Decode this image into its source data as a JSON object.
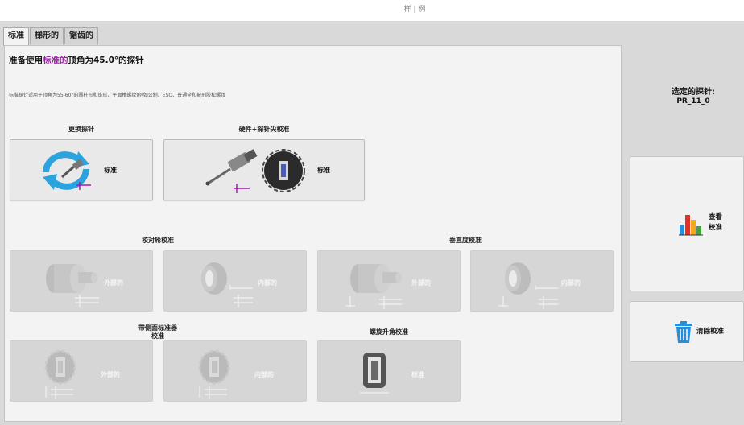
{
  "window": {
    "title": "样 | 例"
  },
  "tabs": [
    {
      "label": "标准",
      "active": true
    },
    {
      "label": "梯形的",
      "active": false
    },
    {
      "label": "锯齿的",
      "active": false
    }
  ],
  "heading": {
    "prefix": "准备使用",
    "highlight": "标准的",
    "suffix": "顶角为45.0°的探针"
  },
  "description": "标准探针适用于顶角为55-60°的圆柱形和锥形、平面槽螺纹(例如公制、ESO、普通全和被刑胶松螺纹",
  "sections": {
    "probe_change": "更换探针",
    "hardware_calibration": "硬件+探针尖校准",
    "diameter_calibration": "校对轮校准",
    "perpendicularity_calibration": "垂直度校准",
    "pitch_diameter_calibration_line1": "带侧面标准器",
    "pitch_diameter_calibration_line2": "校准",
    "helix_angle_calibration": "螺旋升角校准"
  },
  "cards": {
    "probe_change": {
      "label": "标准"
    },
    "hardware_calibration": {
      "label": "标准"
    },
    "diameter_external": {
      "label": "外部的"
    },
    "diameter_internal": {
      "label": "内部的"
    },
    "perpendicular_external": {
      "label": "外部的"
    },
    "perpendicular_internal": {
      "label": "内部的"
    },
    "pitch_external": {
      "label": "外部的"
    },
    "pitch_internal": {
      "label": "内部的"
    },
    "helix_standard": {
      "label": "标准"
    }
  },
  "selected_probe": {
    "label": "选定的探针:",
    "value": "PR_11_0"
  },
  "buttons": {
    "view_calibration": {
      "line1": "查看",
      "line2": "校准"
    },
    "clear_calibration": {
      "label": "清除校准"
    }
  },
  "colors": {
    "highlight": "#9c1fa8",
    "refresh_icon": "#2aa3de",
    "trash_icon": "#2a8fd8"
  }
}
